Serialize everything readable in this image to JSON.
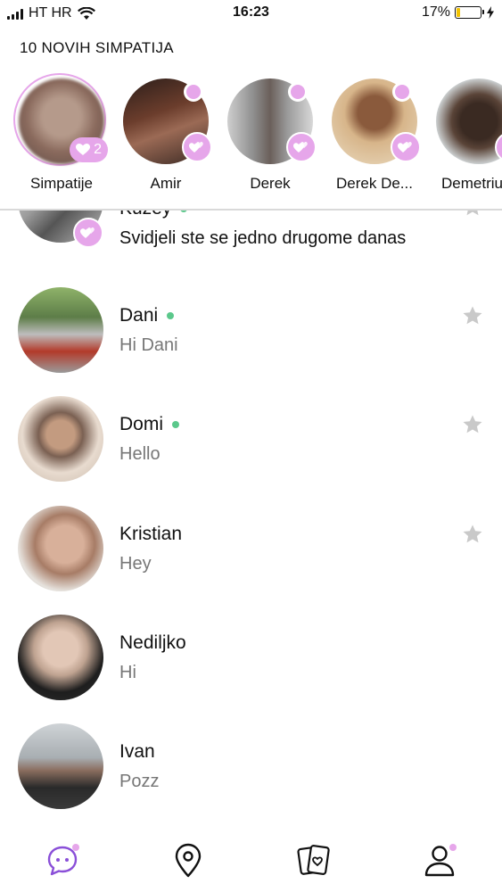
{
  "status": {
    "carrier": "HT HR",
    "time": "16:23",
    "battery": "17%",
    "battery_level": 0.17
  },
  "matches": {
    "heading": "10 NOVIH SIMPATIJA",
    "simpatije": {
      "name": "Simpatije",
      "count": "2"
    },
    "items": [
      {
        "name": "Amir"
      },
      {
        "name": "Derek"
      },
      {
        "name": "Derek De..."
      },
      {
        "name": "Demetriu"
      }
    ]
  },
  "chats": [
    {
      "name": "Kuzey",
      "message": "Svidjeli ste se jedno drugome danas",
      "online": true,
      "favorite": true
    },
    {
      "name": "Dani",
      "message": "Hi Dani",
      "online": true,
      "favorite": true
    },
    {
      "name": "Domi",
      "message": "Hello",
      "online": true,
      "favorite": true
    },
    {
      "name": "Kristian",
      "message": "Hey",
      "online": false,
      "favorite": true
    },
    {
      "name": "Nediljko",
      "message": "Hi",
      "online": false,
      "favorite": false
    },
    {
      "name": "Ivan",
      "message": "Pozz",
      "online": false,
      "favorite": false
    }
  ],
  "tabs": [
    {
      "icon": "chat-bubble-icon",
      "active": true
    },
    {
      "icon": "map-pin-icon",
      "active": false
    },
    {
      "icon": "cards-icon",
      "active": false
    },
    {
      "icon": "profile-icon",
      "active": false
    }
  ],
  "colors": {
    "accent": "#e6a6ea",
    "online": "#5bc88b",
    "active_tab": "#8a4fd8",
    "battery": "#f2c200"
  }
}
